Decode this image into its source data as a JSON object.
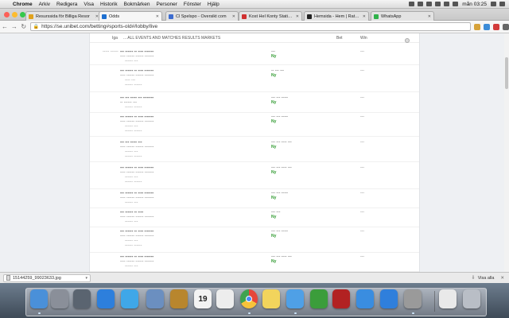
{
  "menubar": {
    "app_name": "Chrome",
    "items": [
      "Arkiv",
      "Redigera",
      "Visa",
      "Historik",
      "Bokmärken",
      "Personer",
      "Fönster",
      "Hjälp"
    ],
    "clock": "mån 03:25"
  },
  "tabs": [
    {
      "label": "Resurssida för Billiga Resor",
      "favicon_color": "#e0a21d",
      "active": false
    },
    {
      "label": "Odds",
      "favicon_color": "#1e6fd0",
      "active": true
    },
    {
      "label": "Cl Spelspo - Oversikt com",
      "favicon_color": "#3d6ccf",
      "active": false
    },
    {
      "label": "Kost Hel Konty Statis - Nov Onl",
      "favicon_color": "#d03030",
      "active": false
    },
    {
      "label": "Hemsida - Hem | Ratkoachi",
      "favicon_color": "#222222",
      "active": false
    },
    {
      "label": "WhatsApp",
      "favicon_color": "#2fb24a",
      "active": false
    }
  ],
  "address": {
    "url": "https://se.unibet.com/betting#sports-old#/lobby/live"
  },
  "table_header": {
    "col1": "Iga",
    "col2": "... ALL EVENTS AND MATCHES RESULTS MARKETS",
    "col3": "Bet",
    "col4": "Win"
  },
  "rows": [
    {
      "lead": "----- ------",
      "title": "--- ------ -- ---- -------",
      "sub": "---- ------ ------ -------",
      "sub2": "------ ---",
      "sub3": "",
      "odds": "---",
      "tag": "Ny",
      "num": "---"
    },
    {
      "lead": "",
      "title": "--- ------ -- ---- -------",
      "sub": "---- ------ ------ -------",
      "sub2": "---- ---",
      "sub3": "------ ------",
      "odds": "-- --- ---",
      "tag": "Ny",
      "num": "---"
    },
    {
      "lead": "",
      "title": "--- --- ----- --- --------",
      "sub": "-- ------ ---",
      "sub2": "------ ------",
      "sub3": "",
      "odds": "--- --- -----",
      "tag": "Ny",
      "num": "---"
    },
    {
      "lead": "",
      "title": "--- ------ -- ---- -------",
      "sub": "---- ------ ------ -------",
      "sub2": "------ ---",
      "sub3": "------ ------",
      "odds": "--- --- -----",
      "tag": "Ny",
      "num": "---"
    },
    {
      "lead": "",
      "title": "--- --- ----- ---",
      "sub": "---- ------ ------ -------",
      "sub2": "------ ---",
      "sub3": "------ ------",
      "odds": "--- --- ---- ---",
      "tag": "Ny",
      "num": "---"
    },
    {
      "lead": "",
      "title": "--- ------ -- ---- -------",
      "sub": "---- ------ ------ -------",
      "sub2": "------ ---",
      "sub3": "------ ------",
      "odds": "--- --- ---- ---",
      "tag": "Ny",
      "num": "---"
    },
    {
      "lead": "",
      "title": "--- ------ -- ---- -------",
      "sub": "---- ------ ------ -------",
      "sub2": "------ ---",
      "sub3": "",
      "odds": "--- --- -----",
      "tag": "Ny",
      "num": "---"
    },
    {
      "lead": "",
      "title": "--- ------ -- ----",
      "sub": "---- ------ ------ -------",
      "sub2": "------ ---",
      "sub3": "",
      "odds": "--- ---",
      "tag": "Ny",
      "num": "---"
    },
    {
      "lead": "",
      "title": "--- ------ -- ---- -------",
      "sub": "---- ------ ------ -------",
      "sub2": "------ ---",
      "sub3": "------ ------",
      "odds": "--- --- -----",
      "tag": "Ny",
      "num": "---"
    },
    {
      "lead": "",
      "title": "--- ------ -- ---- -------",
      "sub": "---- ------ ------ -------",
      "sub2": "------ ---",
      "sub3": "",
      "odds": "--- --- ---- ---",
      "tag": "Ny",
      "num": "---"
    }
  ],
  "downloads": {
    "file": "15144259_99023633.jpg",
    "show_all": "Visa alla"
  },
  "dock": [
    {
      "name": "finder-icon",
      "color": "#4a90d9"
    },
    {
      "name": "launchpad-icon",
      "color": "#8a8f99"
    },
    {
      "name": "mission-control-icon",
      "color": "#5a6470"
    },
    {
      "name": "app-store-icon",
      "color": "#2d7fdc"
    },
    {
      "name": "safari-icon",
      "color": "#3fa7e8"
    },
    {
      "name": "mail-icon",
      "color": "#6b8fc0"
    },
    {
      "name": "contacts-icon",
      "color": "#b8862e"
    },
    {
      "name": "calendar-icon",
      "color": "#f3f3f3"
    },
    {
      "name": "reminders-icon",
      "color": "#ededed"
    },
    {
      "name": "chrome-icon",
      "color": "#e6463b"
    },
    {
      "name": "notes-icon",
      "color": "#f2d45c"
    },
    {
      "name": "messages-icon",
      "color": "#4fa0e6"
    },
    {
      "name": "facetime-icon",
      "color": "#3b9d3b"
    },
    {
      "name": "photo-booth-icon",
      "color": "#b22222"
    },
    {
      "name": "itunes-icon",
      "color": "#3a8de0"
    },
    {
      "name": "app-store-updates-icon",
      "color": "#2f7fdc"
    },
    {
      "name": "system-preferences-icon",
      "color": "#9a9a9a"
    },
    {
      "name": "documents-icon",
      "color": "#e9e9e9"
    },
    {
      "name": "trash-icon",
      "color": "#b9bec6"
    }
  ],
  "calendar_day": "19"
}
